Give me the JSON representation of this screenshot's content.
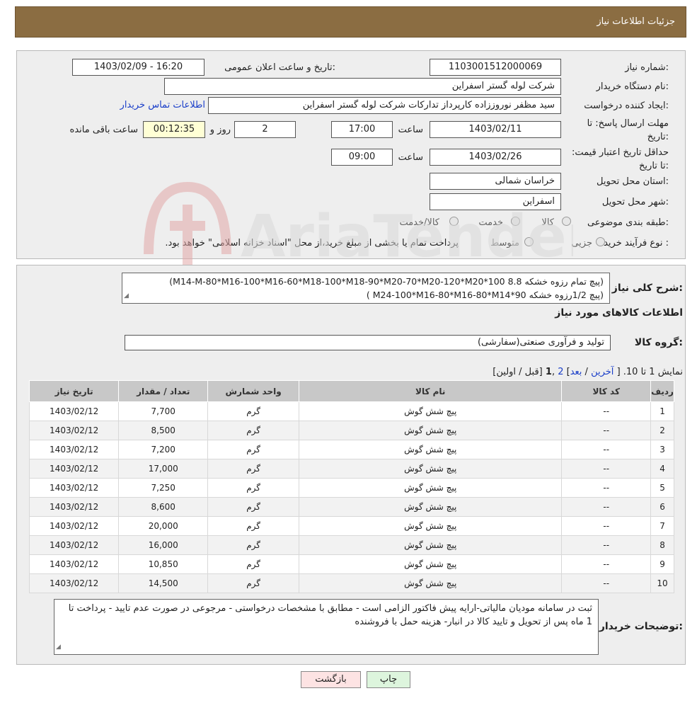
{
  "header": {
    "title": "جزئیات اطلاعات نیاز"
  },
  "form": {
    "need_number_label": "شماره نیاز:",
    "need_number": "1103001512000069",
    "announce_label": "تاریخ و ساعت اعلان عمومی:",
    "announce_value": "1403/02/09 - 16:20",
    "buyer_org_label": "نام دستگاه خریدار:",
    "buyer_org": "شرکت لوله گستر اسفراین",
    "creator_label": "ایجاد کننده درخواست:",
    "creator": "سید مظفر نوروززاده کارپرداز تدارکات شرکت لوله گستر اسفراین",
    "contact_link": "اطلاعات تماس خریدار",
    "deadline_label": "مهلت ارسال پاسخ: تا تاریخ:",
    "deadline_date": "1403/02/11",
    "time_label": "ساعت",
    "deadline_time": "17:00",
    "days_value": "2",
    "days_label": "روز و",
    "remaining_time": "00:12:35",
    "remaining_label": "ساعت باقی مانده",
    "validity_label": "حداقل تاریخ اعتبار قیمت: تا تاریخ:",
    "validity_date": "1403/02/26",
    "validity_time": "09:00",
    "province_label": "استان محل تحویل:",
    "province": "خراسان شمالی",
    "city_label": "شهر محل تحویل:",
    "city": "اسفراین",
    "category_label": "طبقه بندی موضوعی:",
    "category_options": [
      "کالا",
      "خدمت",
      "کالا/خدمت"
    ],
    "process_label": "نوع فرآیند خرید :",
    "process_options": [
      "جزیی",
      "متوسط"
    ],
    "process_note": "پرداخت تمام یا بخشی از مبلغ خرید،از محل \"اسناد خزانه اسلامی\" خواهد بود."
  },
  "details": {
    "summary_label": "شرح کلی نیاز:",
    "summary_line1": "(پیچ تمام رزوه خشکه 8.8 100*M14-M-80*M16-100*M16-60*M18-100*M18-90*M20-70*M20-120*M20)",
    "summary_line2": "(پیچ 1/2رزوه خشکه 90*M24-100*M16-80*M16-80*M14 )",
    "goods_info_title": "اطلاعات کالاهای مورد نیاز",
    "group_label": "گروه کالا:",
    "group_value": "تولید و فرآوری صنعتی(سفارشی)",
    "pagination_text": "نمایش 1 تا 10. [",
    "pager_last": "آخرین",
    "pager_next": "بعد",
    "pager_page2": "2",
    "pager_page1": "1",
    "pager_tail": "[قبل / اولین]",
    "table": {
      "headers": [
        "ردیف",
        "کد کالا",
        "نام کالا",
        "واحد شمارش",
        "تعداد / مقدار",
        "تاریخ نیاز"
      ],
      "rows": [
        [
          "1",
          "--",
          "پیچ شش گوش",
          "گرم",
          "7,700",
          "1403/02/12"
        ],
        [
          "2",
          "--",
          "پیچ شش گوش",
          "گرم",
          "8,500",
          "1403/02/12"
        ],
        [
          "3",
          "--",
          "پیچ شش گوش",
          "گرم",
          "7,200",
          "1403/02/12"
        ],
        [
          "4",
          "--",
          "پیچ شش گوش",
          "گرم",
          "17,000",
          "1403/02/12"
        ],
        [
          "5",
          "--",
          "پیچ شش گوش",
          "گرم",
          "7,250",
          "1403/02/12"
        ],
        [
          "6",
          "--",
          "پیچ شش گوش",
          "گرم",
          "8,600",
          "1403/02/12"
        ],
        [
          "7",
          "--",
          "پیچ شش گوش",
          "گرم",
          "20,000",
          "1403/02/12"
        ],
        [
          "8",
          "--",
          "پیچ شش گوش",
          "گرم",
          "16,000",
          "1403/02/12"
        ],
        [
          "9",
          "--",
          "پیچ شش گوش",
          "گرم",
          "10,850",
          "1403/02/12"
        ],
        [
          "10",
          "--",
          "پیچ شش گوش",
          "گرم",
          "14,500",
          "1403/02/12"
        ]
      ]
    },
    "buyer_notes_label": "توضیحات خریدار:",
    "buyer_notes": "ثبت در سامانه مودیان مالیاتی-ارایه پیش فاکتور الزامی است - مطابق با مشخصات درخواستی - مرجوعی در صورت عدم تایید - پرداخت تا 1 ماه پس از تحویل و تایید کالا در انبار- هزینه حمل با فروشنده"
  },
  "buttons": {
    "print": "چاپ",
    "back": "بازگشت"
  },
  "watermark": {
    "text": "AriaTender.neT"
  },
  "colors": {
    "header_bg": "#8b6d42",
    "back_button_bg": "#fde3e3",
    "print_button_bg": "#ddf5dd",
    "link": "#1a3ec9"
  }
}
